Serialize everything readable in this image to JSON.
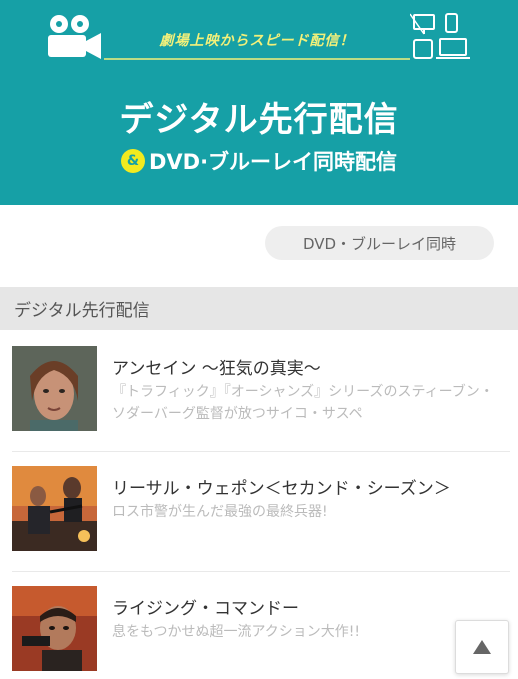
{
  "hero": {
    "tagline": "劇場上映からスピード配信！",
    "title": "デジタル先行配信",
    "amp": "&",
    "subtitle": "DVD·ブルーレイ同時配信"
  },
  "filter": {
    "label": "DVD・ブルーレイ同時"
  },
  "section": {
    "label": "デジタル先行配信"
  },
  "items": [
    {
      "title": "アンセイン 〜狂気の真実〜",
      "description": "『トラフィック』『オーシャンズ』シリーズのスティーブン・ソダーバーグ監督が放つサイコ・サスペ"
    },
    {
      "title": "リーサル・ウェポン＜セカンド・シーズン＞",
      "description": "ロス市警が生んだ最強の最終兵器!"
    },
    {
      "title": "ライジング・コマンドー",
      "description": "息をもつかせぬ超一流アクション大作!!"
    }
  ],
  "colors": {
    "brand_teal": "#16a0a6",
    "accent_yellow": "#f2ea1f"
  },
  "icons": {
    "hero_left": "movie-camera-icon",
    "hero_right": "devices-icon",
    "page_top": "up-arrow-icon"
  }
}
